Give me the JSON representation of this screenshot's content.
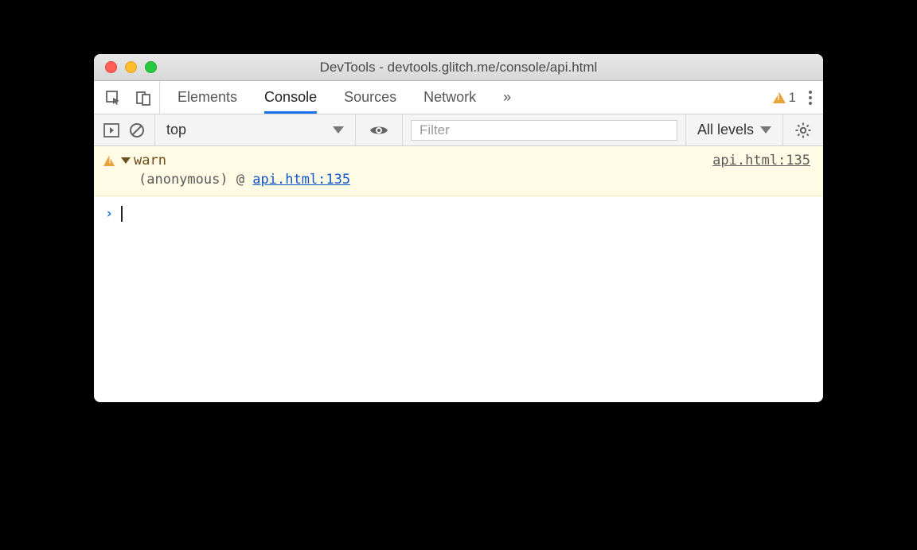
{
  "window": {
    "title": "DevTools - devtools.glitch.me/console/api.html"
  },
  "tabs": {
    "items": [
      "Elements",
      "Console",
      "Sources",
      "Network"
    ],
    "active": "Console",
    "warning_count": "1"
  },
  "filterbar": {
    "context": "top",
    "filter_placeholder": "Filter",
    "filter_value": "",
    "levels_label": "All levels"
  },
  "console": {
    "warn": {
      "message": "warn",
      "source_link": "api.html:135",
      "trace_label": "(anonymous) @ ",
      "trace_link": "api.html:135"
    }
  }
}
